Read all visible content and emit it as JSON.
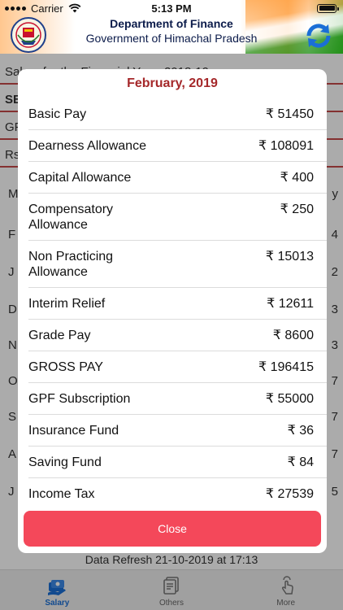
{
  "status_bar": {
    "carrier": "Carrier",
    "time": "5:13 PM"
  },
  "header": {
    "title_line1": "Department of Finance",
    "title_line2": "Government of Himachal Pradesh"
  },
  "background": {
    "row1_text": "Salary for the Financial Year: 2018-19",
    "row2_text": "SE",
    "row3_text": "GP",
    "row4_text": "Rs",
    "left_letters": [
      "M",
      "F",
      "J",
      "D",
      "N",
      "O",
      "S",
      "A",
      "J"
    ],
    "right_digits": [
      "y",
      "4",
      "2",
      "3",
      "3",
      "7",
      "7",
      "7",
      "5"
    ],
    "refresh_text": "Data Refresh 21-10-2019 at 17:13"
  },
  "modal": {
    "title": "February, 2019",
    "rows": [
      {
        "label": "Basic Pay",
        "value": "₹ 51450"
      },
      {
        "label": "Dearness Allowance",
        "value": "₹ 108091"
      },
      {
        "label": "Capital Allowance",
        "value": "₹ 400"
      },
      {
        "label": "Compensatory Allowance",
        "value": "₹ 250"
      },
      {
        "label": "Non Practicing Allowance",
        "value": "₹ 15013"
      },
      {
        "label": "Interim Relief",
        "value": "₹ 12611"
      },
      {
        "label": "Grade Pay",
        "value": "₹ 8600"
      },
      {
        "label": "GROSS PAY",
        "value": "₹ 196415"
      },
      {
        "label": "GPF Subscription",
        "value": "₹ 55000"
      },
      {
        "label": "Insurance Fund",
        "value": "₹ 36"
      },
      {
        "label": "Saving Fund",
        "value": "₹ 84"
      },
      {
        "label": "Income Tax",
        "value": "₹ 27539"
      }
    ],
    "close_label": "Close"
  },
  "tabs": [
    {
      "label": "Salary",
      "active": true
    },
    {
      "label": "Others",
      "active": false
    },
    {
      "label": "More",
      "active": false
    }
  ],
  "colors": {
    "accent_red": "#a5282a",
    "close_button": "#f4485a",
    "active_tab": "#1a6fd6"
  }
}
